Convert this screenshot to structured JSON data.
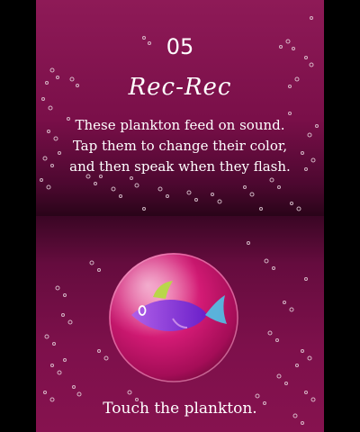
{
  "level": {
    "number": "05",
    "name": "Rec-Rec"
  },
  "description": {
    "lines": [
      "These plankton feed on sound.",
      "Tap them to change their color,",
      "and then speak when they flash."
    ]
  },
  "instruction": "Touch the plankton.",
  "colors": {
    "background_top": "#8e1a57",
    "background_dark": "#2a0419",
    "orb": "#d21a74",
    "fish_body": "#8a2be2",
    "fish_fin": "#b9d64a",
    "fish_tail": "#4fc3e8",
    "text": "#ffffff"
  },
  "icons": {
    "orb": "plankton-orb",
    "fish": "plankton-fish-icon",
    "bubbles": "bubble-icon"
  }
}
